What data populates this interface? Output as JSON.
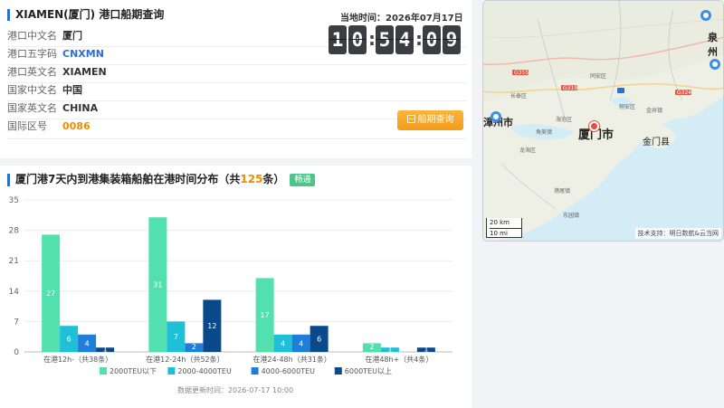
{
  "port": {
    "title": "XIAMEN(厦门) 港口船期查询",
    "rows": [
      {
        "label": "港口中文名",
        "value": "厦门",
        "style": "normal"
      },
      {
        "label": "港口五字码",
        "value": "CNXMN",
        "style": "blue"
      },
      {
        "label": "港口英文名",
        "value": "XIAMEN",
        "style": "normal"
      },
      {
        "label": "国家中文名",
        "value": "中国",
        "style": "normal"
      },
      {
        "label": "国家英文名",
        "value": "CHINA",
        "style": "normal"
      },
      {
        "label": "国际区号",
        "value": "0086",
        "style": "orange"
      }
    ],
    "clock_label": "当地时间：2026年07月17日",
    "clock_digits": [
      "1",
      "0",
      "5",
      "4",
      "0",
      "9"
    ],
    "clock_separator": ":",
    "query_button": "船期查询"
  },
  "chart_section": {
    "title_prefix": "厦门港7天内到港集装箱船舶在港时间分布（共",
    "total_count": "125",
    "title_suffix": "条）",
    "status_badge": "畅通",
    "update_time": "数据更新时间：2026-07-17 10:00"
  },
  "chart_data": {
    "type": "bar",
    "categories": [
      "在港12h-（共38条）",
      "在港12-24h（共52条）",
      "在港24-48h（共31条）",
      "在港48h+（共4条）"
    ],
    "series": [
      {
        "name": "2000TEU以下",
        "color": "#52e0ae",
        "values": [
          27,
          31,
          17,
          2
        ]
      },
      {
        "name": "2000-4000TEU",
        "color": "#1fbfd8",
        "values": [
          6,
          7,
          4,
          1
        ]
      },
      {
        "name": "4000-6000TEU",
        "color": "#1e7fdb",
        "values": [
          4,
          2,
          4,
          0
        ]
      },
      {
        "name": "6000TEU以上",
        "color": "#0b4a8a",
        "values": [
          1,
          12,
          6,
          1
        ]
      }
    ],
    "yticks": [
      "0",
      "7",
      "14",
      "21",
      "28",
      "35"
    ],
    "ylim": [
      0,
      35
    ],
    "data_labels": true,
    "legend_position": "bottom",
    "grid": true
  },
  "map": {
    "city_label": "厦门市",
    "labels": [
      "漳州市",
      "金门县",
      "泉州"
    ],
    "small_labels": [
      "G355",
      "G319",
      "G324",
      "长泰区",
      "同安区",
      "翔安区",
      "龙海区",
      "海沧区",
      "角美镇",
      "金井镇",
      "港尾镇",
      "东园镇"
    ],
    "scale_km": "20 km",
    "scale_mi": "10 mi",
    "attribution": "技术支持：明日数航&云当网"
  }
}
